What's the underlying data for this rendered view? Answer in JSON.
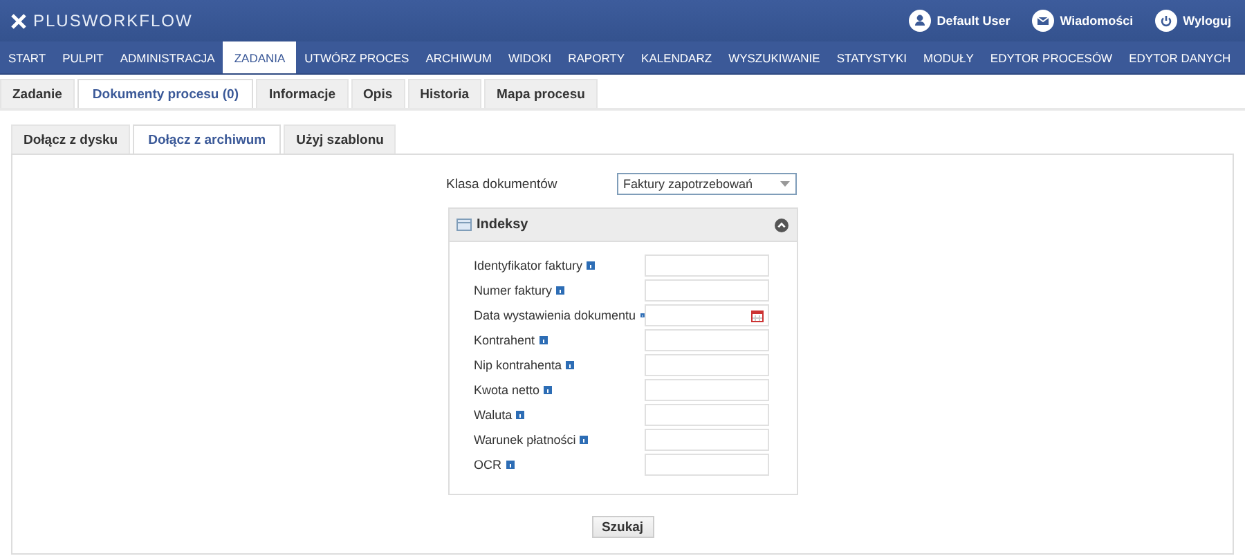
{
  "header": {
    "logo": "PLUSWORKFLOW",
    "links": [
      {
        "kind": "user",
        "label": "Default User"
      },
      {
        "kind": "mail",
        "label": "Wiadomości"
      },
      {
        "kind": "power",
        "label": "Wyloguj"
      }
    ]
  },
  "nav": [
    {
      "label": "START",
      "selected": false
    },
    {
      "label": "PULPIT",
      "selected": false
    },
    {
      "label": "ADMINISTRACJA",
      "selected": false
    },
    {
      "label": "ZADANIA",
      "selected": true
    },
    {
      "label": "UTWÓRZ PROCES",
      "selected": false
    },
    {
      "label": "ARCHIWUM",
      "selected": false
    },
    {
      "label": "WIDOKI",
      "selected": false
    },
    {
      "label": "RAPORTY",
      "selected": false
    },
    {
      "label": "KALENDARZ",
      "selected": false
    },
    {
      "label": "WYSZUKIWANIE",
      "selected": false
    },
    {
      "label": "STATYSTYKI",
      "selected": false
    },
    {
      "label": "MODUŁY",
      "selected": false
    },
    {
      "label": "EDYTOR PROCESÓW",
      "selected": false
    },
    {
      "label": "EDYTOR DANYCH",
      "selected": false
    }
  ],
  "task_tabs": [
    {
      "label": "Zadanie",
      "selected": false
    },
    {
      "label": "Dokumenty procesu (0)",
      "selected": true
    },
    {
      "label": "Informacje",
      "selected": false
    },
    {
      "label": "Opis",
      "selected": false
    },
    {
      "label": "Historia",
      "selected": false
    },
    {
      "label": "Mapa procesu",
      "selected": false
    }
  ],
  "attach_tabs": [
    {
      "label": "Dołącz z dysku",
      "selected": false
    },
    {
      "label": "Dołącz z archiwum",
      "selected": true
    },
    {
      "label": "Użyj szablonu",
      "selected": false
    }
  ],
  "form": {
    "class_label": "Klasa dokumentów",
    "class_value": "Faktury zapotrzebowań",
    "panel": {
      "title": "Indeksy",
      "expanded": true,
      "fields": [
        {
          "label": "Identyfikator faktury",
          "kind": "text"
        },
        {
          "label": "Numer faktury",
          "kind": "text"
        },
        {
          "label": "Data wystawienia dokumentu",
          "kind": "date"
        },
        {
          "label": "Kontrahent",
          "kind": "text"
        },
        {
          "label": "Nip kontrahenta",
          "kind": "text"
        },
        {
          "label": "Kwota netto",
          "kind": "text"
        },
        {
          "label": "Waluta",
          "kind": "text"
        },
        {
          "label": "Warunek płatności",
          "kind": "text"
        },
        {
          "label": "OCR",
          "kind": "text"
        }
      ]
    },
    "button": "Szukaj"
  }
}
